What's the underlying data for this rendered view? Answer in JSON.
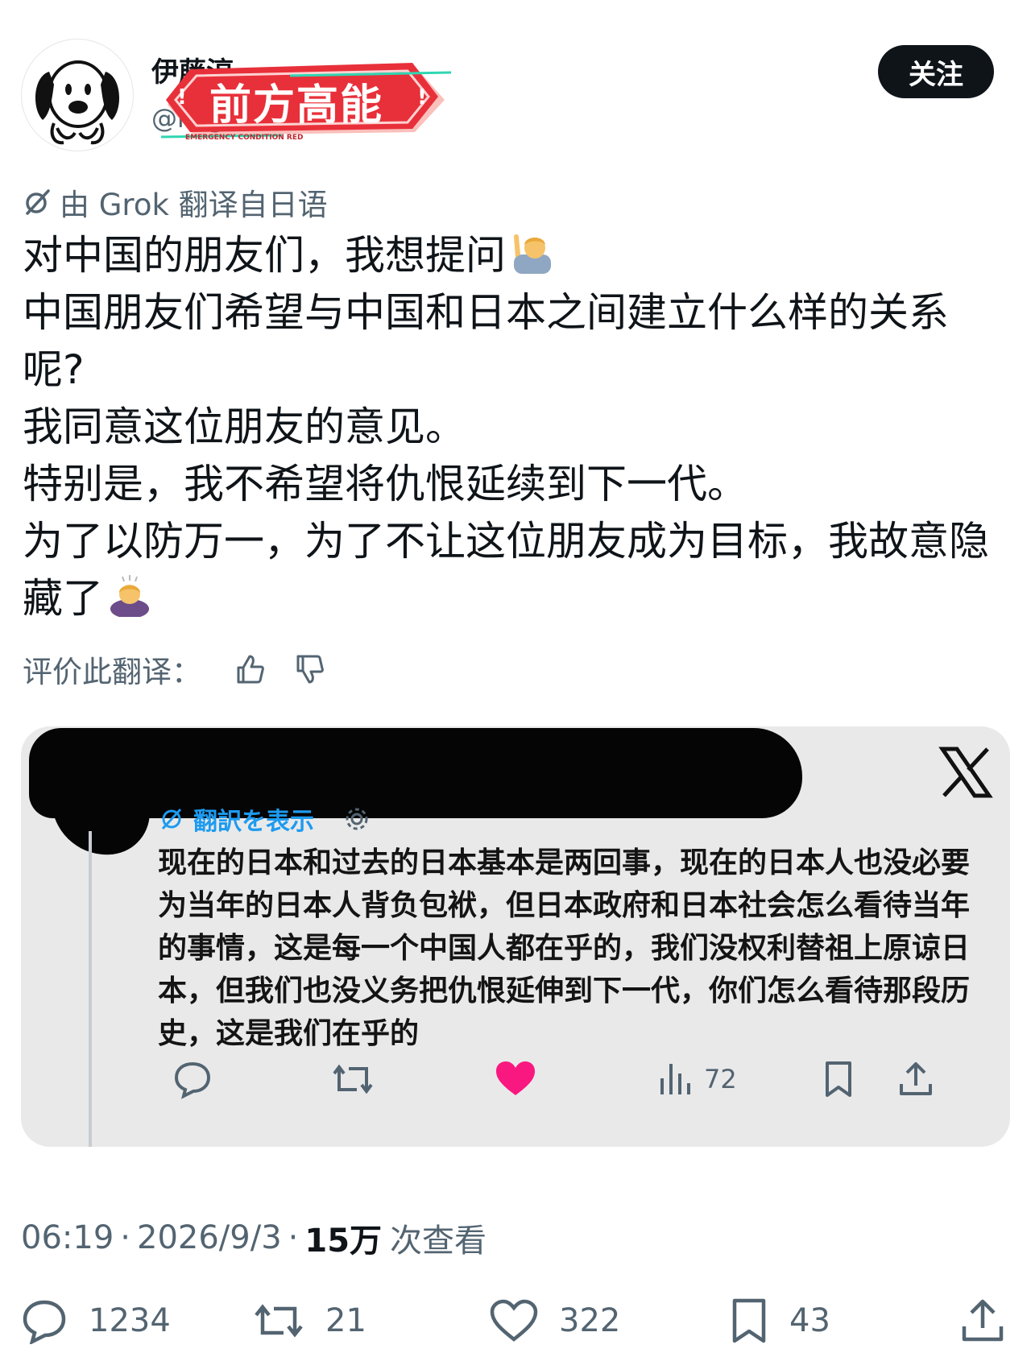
{
  "author": {
    "name": "伊藤淳",
    "handle": "@kagam0303",
    "follow_label": "关注",
    "sticker_text": "前方高能",
    "sticker_subtext": "EMERGENCY CONDITION RED"
  },
  "translation": {
    "note": "由 Grok 翻译自日语",
    "rate_label": "评价此翻译："
  },
  "tweet": {
    "lines": [
      "对中国的朋友们，我想提问",
      "中国朋友们希望与中国和日本之间建立什么样的关系呢?",
      "我同意这位朋友的意见。",
      "特别是，我不希望将仇恨延续到下一代。",
      "为了以防万一，为了不让这位朋友成为目标，我故意隐藏了"
    ]
  },
  "quoted": {
    "translate_link": "翻訳を表示",
    "text": "现在的日本和过去的日本基本是两回事，现在的日本人也没必要为当年的日本人背负包袱，但日本政府和日本社会怎么看待当年的事情，这是每一个中国人都在乎的，我们没权利替祖上原谅日本，但我们也没义务把仇恨延伸到下一代，你们怎么看待那段历史，这是我们在乎的",
    "views": "72"
  },
  "meta": {
    "time": "06:19",
    "date": "2026/9/3",
    "views": "15万",
    "views_label": "次查看"
  },
  "actions": {
    "replies": "1234",
    "retweets": "21",
    "likes": "322",
    "bookmarks": "43"
  },
  "colors": {
    "text": "#0f1419",
    "secondary": "#536471",
    "link": "#1d9bf0",
    "like_pink": "#f91880",
    "sticker_red": "#e8303a"
  }
}
